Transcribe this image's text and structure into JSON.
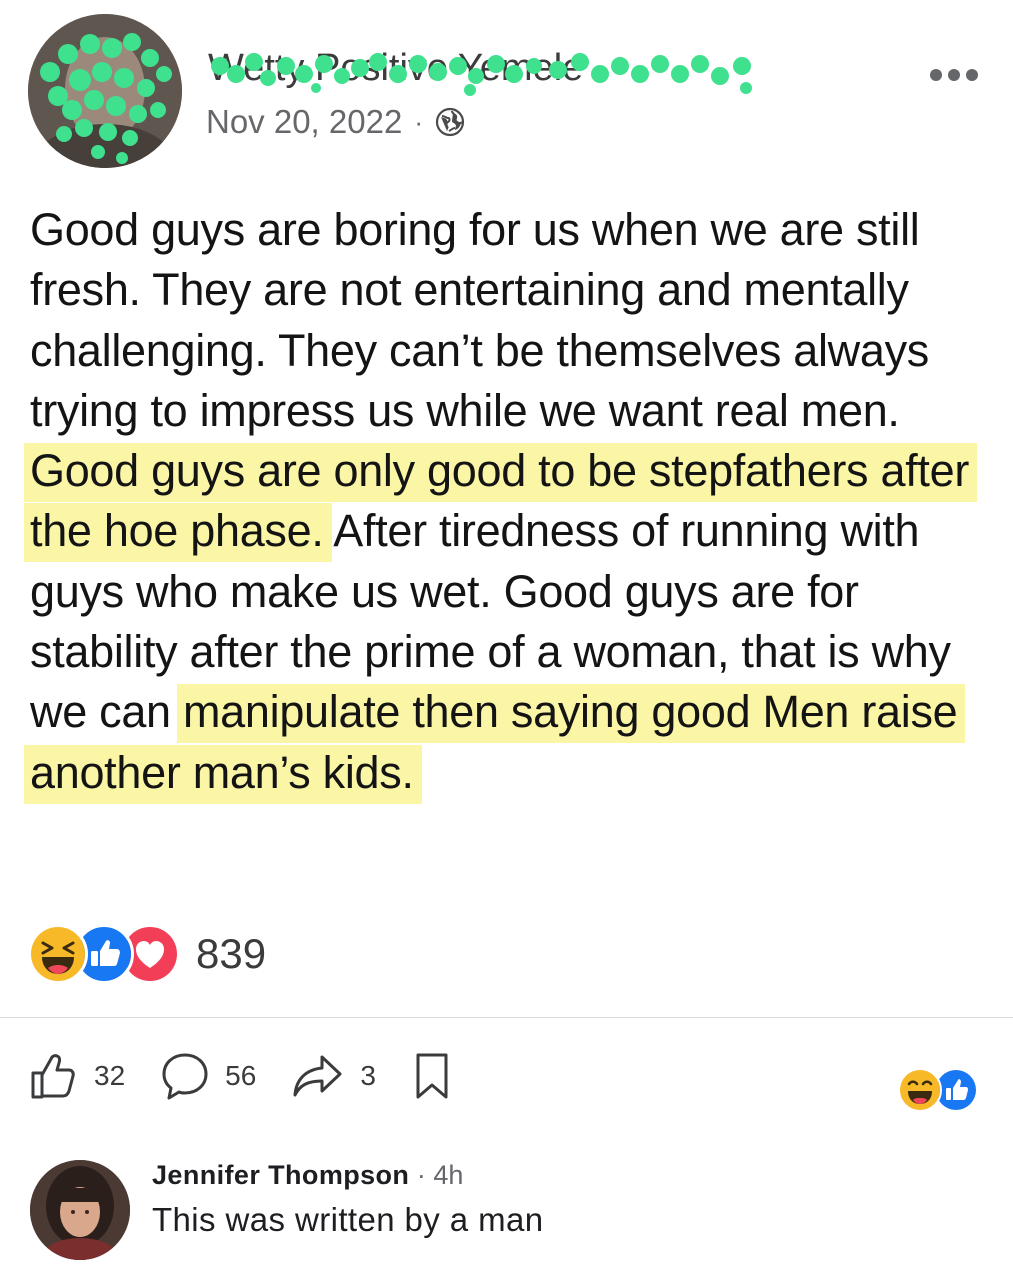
{
  "post": {
    "author_name": "Wetty Positive Yemele",
    "date": "Nov 20, 2022",
    "separator": "·",
    "privacy_icon": "globe-icon",
    "more_icon": "more-horizontal-icon",
    "text_segments": [
      {
        "text": "Good guys are boring for us when we are still fresh. They are not entertaining and mentally challenging. They can’t be themselves always trying to impress us while we want real men. ",
        "highlight": false
      },
      {
        "text": "Good guys are only good to be stepfathers after the hoe phase.",
        "highlight": true
      },
      {
        "text": " After tiredness of running with guys who make us wet. Good guys are for stability after the prime of a woman, that is why we can ",
        "highlight": false
      },
      {
        "text": "manipulate then saying good Men raise another man’s kids.",
        "highlight": true
      }
    ],
    "highlight_color": "#fbf6a6",
    "reactions": {
      "icons": [
        "laughing-face-icon",
        "like-icon",
        "love-icon"
      ],
      "count": "839"
    }
  },
  "actions": {
    "like": {
      "icon": "thumbs-up-icon",
      "count": "32"
    },
    "comment": {
      "icon": "comment-bubble-icon",
      "count": "56"
    },
    "share": {
      "icon": "share-arrow-icon",
      "count": "3"
    },
    "save": {
      "icon": "bookmark-icon"
    }
  },
  "comment": {
    "author": "Jennifer Thompson",
    "separator": " · ",
    "time": "4h",
    "text": "This was written by a man",
    "reactions": [
      "laughing-face-icon",
      "like-icon"
    ]
  },
  "colors": {
    "like_blue": "#1877f2",
    "love_red": "#f33e58",
    "haha_yellow": "#f7b928",
    "redaction_green": "#3fe08e"
  }
}
